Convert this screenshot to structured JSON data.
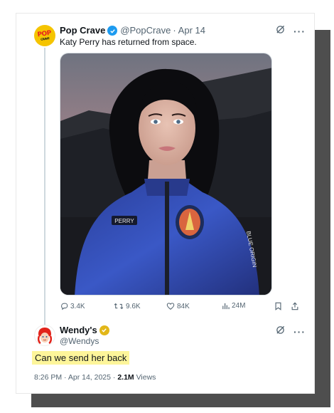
{
  "original_tweet": {
    "author_name": "Pop Crave",
    "handle": "@PopCrave",
    "separator": "·",
    "date": "Apr 14",
    "text": "Katy Perry has returned from space.",
    "avatar_text_main": "POP",
    "avatar_text_sub": "CRAVE",
    "more_label": "···",
    "photo": {
      "suit_name_patch": "PERRY",
      "sleeve_text": "BLUE ORIGIN"
    },
    "metrics": {
      "replies": "3.4K",
      "reposts": "9.6K",
      "likes": "84K",
      "views": "24M"
    }
  },
  "reply": {
    "author_name": "Wendy's",
    "handle": "@Wendys",
    "text": "Can we send her back",
    "more_label": "···",
    "timestamp": "8:26 PM · Apr 14, 2025 · ",
    "views_count": "2.1M",
    "views_label": "Views"
  },
  "colors": {
    "verified_blue": "#1d9bf0",
    "verified_gold": "#e2b719",
    "highlight": "#fdf59a",
    "shadow": "#4e4e4e"
  }
}
